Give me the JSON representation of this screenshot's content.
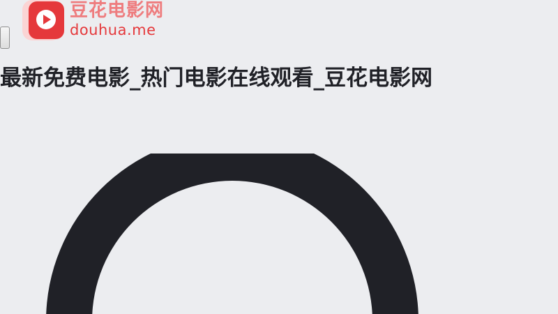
{
  "header": {
    "logo_name": "豆花电影网",
    "logo_domain": "douhua.me"
  },
  "page": {
    "title": "最新免费电影_热门电影在线观看_豆花电影网"
  },
  "loader": {
    "icon": "loading-spinner-icon",
    "color": "#202127"
  },
  "colors": {
    "background": "#ecedf0",
    "brand": "#e5383b",
    "brand_light": "#ee7c7e"
  }
}
